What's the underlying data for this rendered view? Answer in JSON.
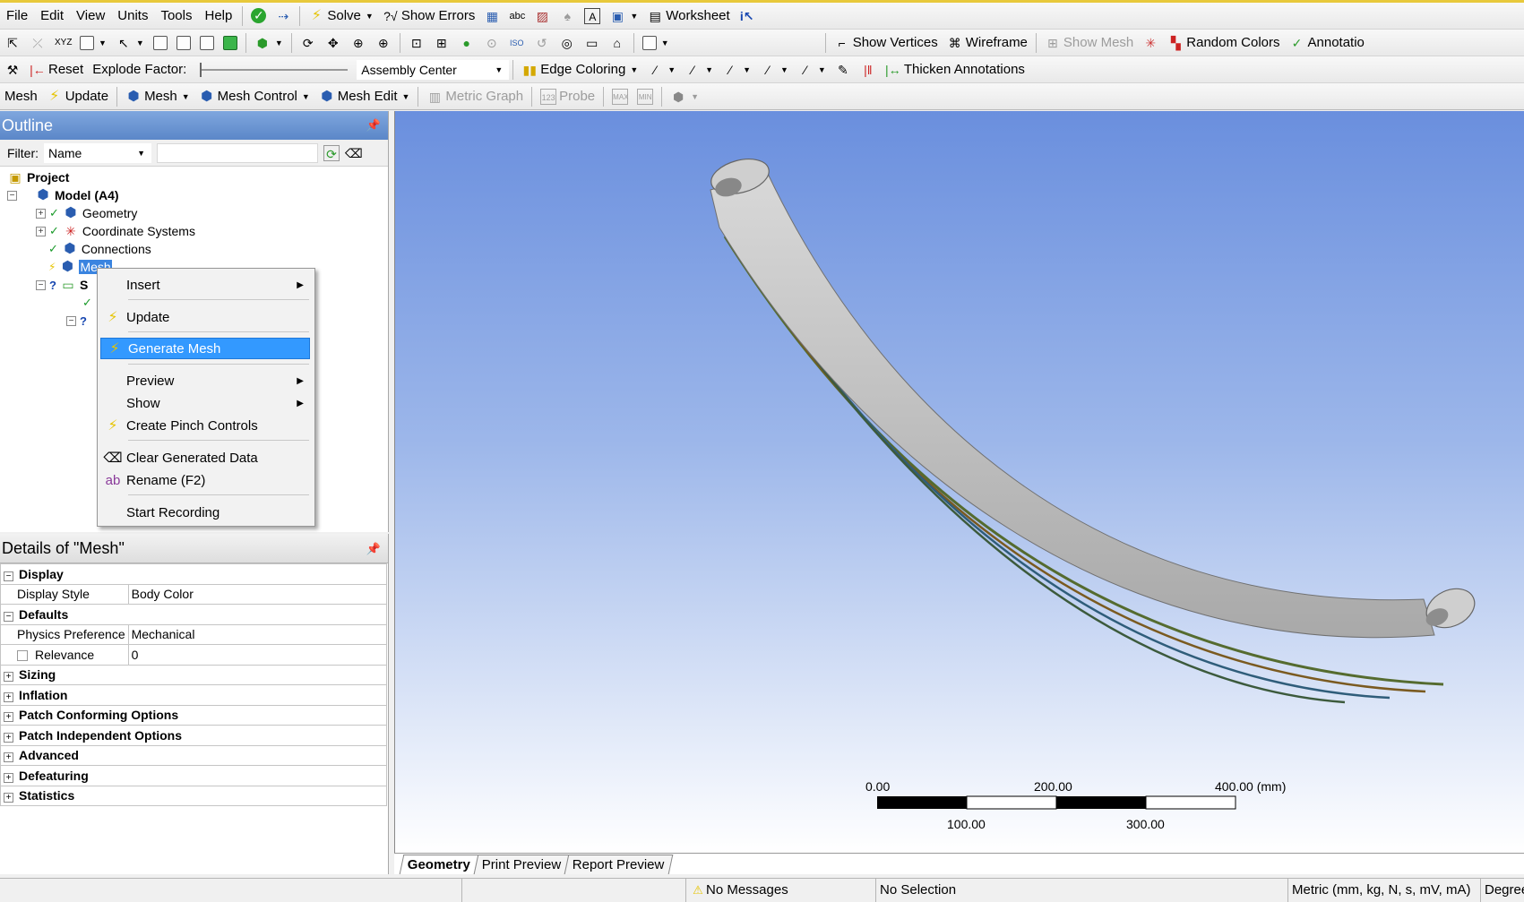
{
  "menu": [
    "File",
    "Edit",
    "View",
    "Units",
    "Tools",
    "Help"
  ],
  "toolbar1": {
    "solve": "Solve",
    "show_errors": "Show Errors",
    "worksheet": "Worksheet"
  },
  "toolbar2": {
    "show_vertices": "Show Vertices",
    "wireframe": "Wireframe",
    "show_mesh": "Show Mesh",
    "random_colors": "Random Colors",
    "annotations": "Annotatio"
  },
  "toolbar3": {
    "reset": "Reset",
    "explode_factor": "Explode Factor:",
    "assembly_center": "Assembly Center",
    "edge_coloring": "Edge Coloring",
    "thicken_annotations": "Thicken Annotations"
  },
  "toolbar4": {
    "mesh": "Mesh",
    "update": "Update",
    "mesh_menu": "Mesh",
    "mesh_control": "Mesh Control",
    "mesh_edit": "Mesh Edit",
    "metric_graph": "Metric Graph",
    "probe": "Probe"
  },
  "outline": {
    "title": "Outline",
    "filter_label": "Filter:",
    "filter_value": "Name",
    "tree": {
      "project": "Project",
      "model": "Model (A4)",
      "geometry": "Geometry",
      "coordinate_systems": "Coordinate Systems",
      "connections": "Connections",
      "mesh": "Mesh",
      "s_partial": "S"
    }
  },
  "context_menu": {
    "insert": "Insert",
    "update": "Update",
    "generate_mesh": "Generate Mesh",
    "preview": "Preview",
    "show": "Show",
    "create_pinch_controls": "Create Pinch Controls",
    "clear_generated_data": "Clear Generated Data",
    "rename": "Rename (F2)",
    "start_recording": "Start Recording"
  },
  "details": {
    "title": "Details of \"Mesh\"",
    "groups": {
      "display": "Display",
      "defaults": "Defaults",
      "sizing": "Sizing",
      "inflation": "Inflation",
      "patch_conforming": "Patch Conforming Options",
      "patch_independent": "Patch Independent Options",
      "advanced": "Advanced",
      "defeaturing": "Defeaturing",
      "statistics": "Statistics"
    },
    "props": {
      "display_style_label": "Display Style",
      "display_style_value": "Body Color",
      "physics_pref_label": "Physics Preference",
      "physics_pref_value": "Mechanical",
      "relevance_label": "Relevance",
      "relevance_value": "0"
    }
  },
  "scale": {
    "top_labels": [
      "0.00",
      "200.00",
      "400.00 (mm)"
    ],
    "bottom_labels": [
      "100.00",
      "300.00"
    ]
  },
  "tabs": [
    "Geometry",
    "Print Preview",
    "Report Preview"
  ],
  "status": {
    "messages": "No Messages",
    "selection": "No Selection",
    "units": "Metric (mm, kg, N, s, mV, mA)",
    "angle": "Degree"
  }
}
